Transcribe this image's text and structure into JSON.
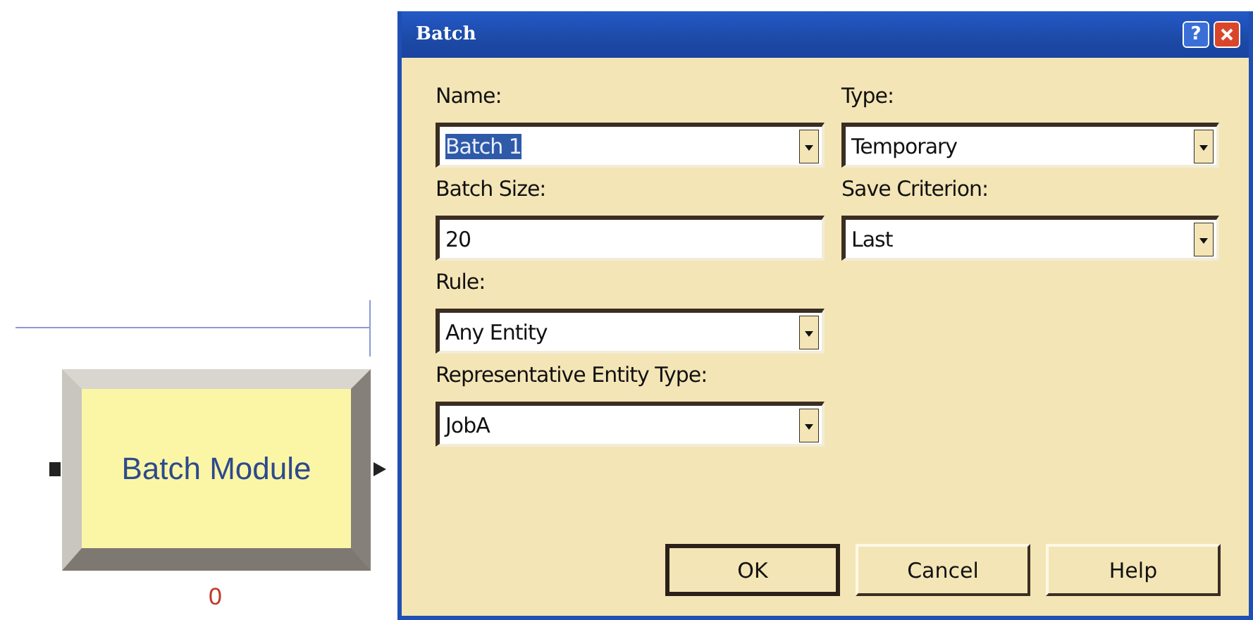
{
  "canvas": {
    "module": {
      "label": "Batch Module",
      "counter": "0"
    }
  },
  "dialog": {
    "title": "Batch",
    "title_buttons": [
      {
        "kind": "help",
        "label": "?"
      },
      {
        "kind": "close"
      }
    ],
    "rows": [
      [
        {
          "label": "Name:",
          "kind": "combo",
          "value": "Batch 1",
          "highlighted": true
        },
        {
          "label": "Type:",
          "kind": "combo",
          "value": "Temporary",
          "highlighted": false
        }
      ],
      [
        {
          "label": "Batch Size:",
          "kind": "text",
          "value": "20",
          "highlighted": false
        },
        {
          "label": "Save Criterion:",
          "kind": "combo",
          "value": "Last",
          "highlighted": false
        }
      ],
      [
        {
          "label": "Rule:",
          "kind": "combo",
          "value": "Any Entity",
          "highlighted": false
        }
      ],
      [
        {
          "label": "Representative Entity Type:",
          "kind": "combo",
          "value": "JobA",
          "highlighted": false
        }
      ]
    ],
    "buttons": [
      {
        "label": "OK",
        "default": true
      },
      {
        "label": "Cancel",
        "default": false
      },
      {
        "label": "Help",
        "default": false
      }
    ]
  }
}
